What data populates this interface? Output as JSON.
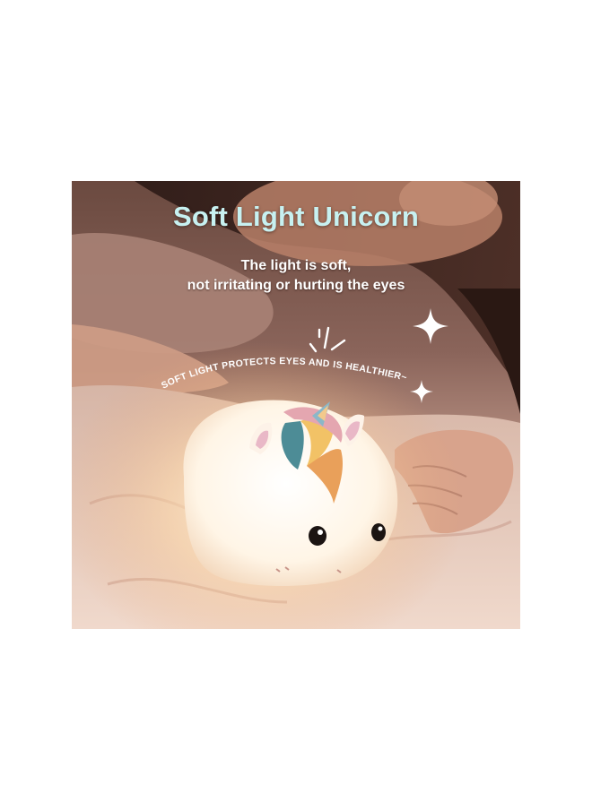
{
  "photo": {
    "headline": "Soft Light Unicorn",
    "subline_1": "The light is soft,",
    "subline_2": "not irritating or hurting the eyes",
    "tagline": "SOFT LIGHT PROTECTS EYES AND IS HEALTHIER~",
    "colors": {
      "headline": "#c7f1f1",
      "text": "#ffffff",
      "glow": "#fff4dc"
    },
    "icons": [
      "sparkle-star-icon",
      "sparkle-small-icon",
      "shine-lines-icon"
    ]
  }
}
